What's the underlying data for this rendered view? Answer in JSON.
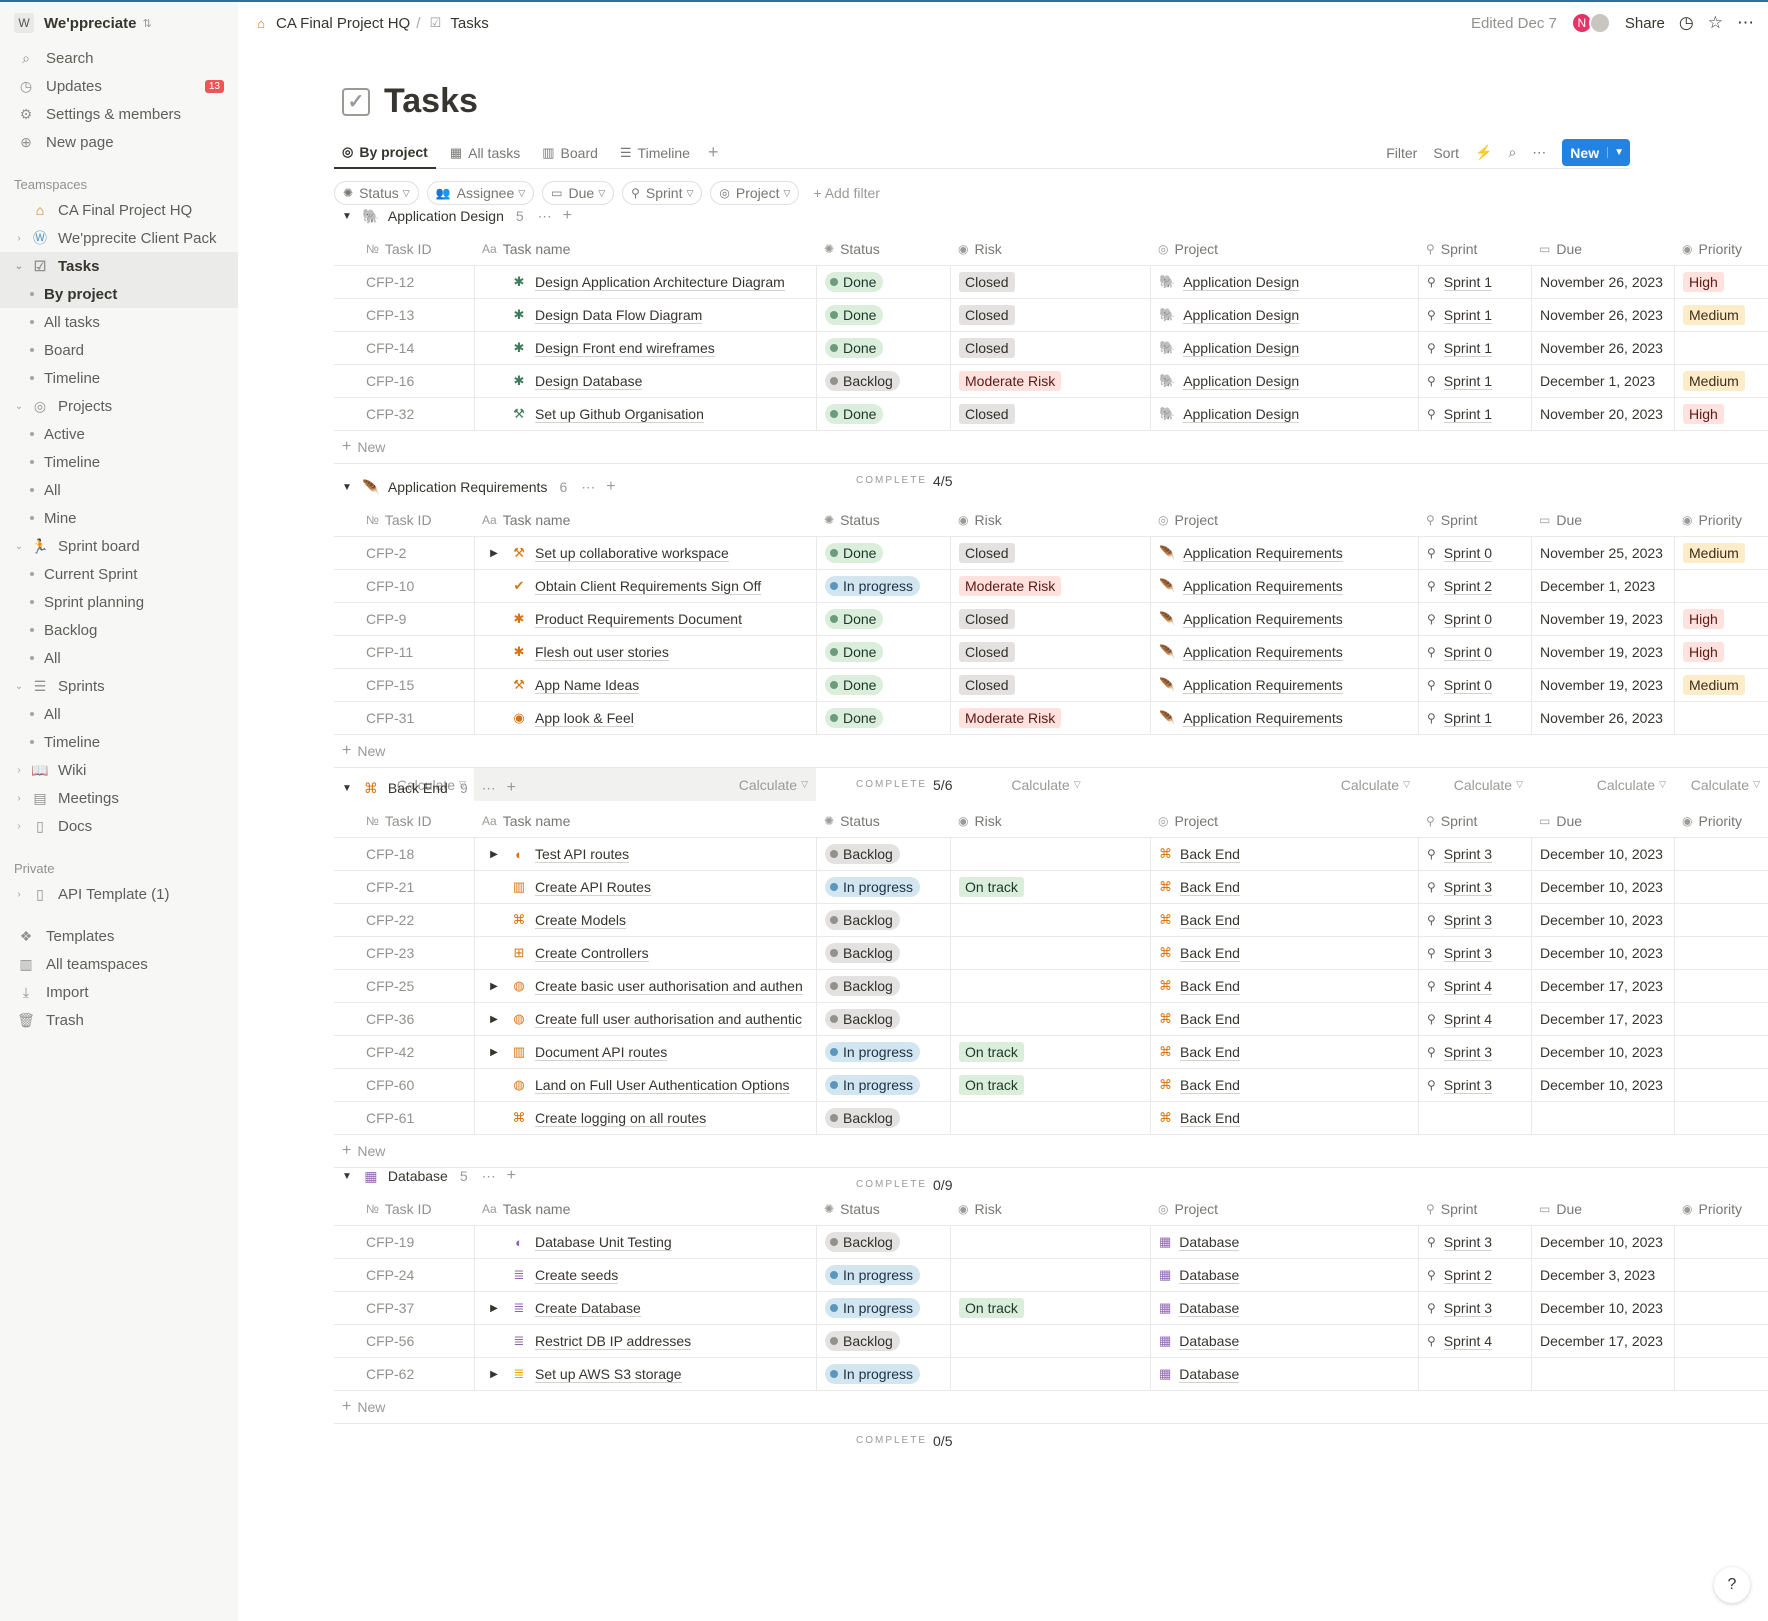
{
  "workspace": {
    "initial": "W",
    "name": "We'ppreciate"
  },
  "sidebar": {
    "top": [
      {
        "label": "Search",
        "icon": "search-icon",
        "glyph": "⌕"
      },
      {
        "label": "Updates",
        "icon": "clock-icon",
        "glyph": "◷",
        "badge": "13"
      },
      {
        "label": "Settings & members",
        "icon": "gear-icon",
        "glyph": "⚙"
      },
      {
        "label": "New page",
        "icon": "plus-circle-icon",
        "glyph": "⊕"
      }
    ],
    "teamspaces_heading": "Teamspaces",
    "teamspace_root": "CA Final Project HQ",
    "client_pack": "We'pprecite Client Pack",
    "tasks": "Tasks",
    "tasks_views": [
      "By project",
      "All tasks",
      "Board",
      "Timeline"
    ],
    "projects": "Projects",
    "projects_views": [
      "Active",
      "Timeline",
      "All",
      "Mine"
    ],
    "sprint_board": "Sprint board",
    "sprint_views": [
      "Current Sprint",
      "Sprint planning",
      "Backlog",
      "All"
    ],
    "sprints": "Sprints",
    "sprints_views": [
      "All",
      "Timeline"
    ],
    "wiki": "Wiki",
    "meetings": "Meetings",
    "docs": "Docs",
    "private_heading": "Private",
    "api_template": "API Template (1)",
    "bottom": [
      {
        "label": "Templates",
        "icon": "templates-icon",
        "glyph": "❖"
      },
      {
        "label": "All teamspaces",
        "icon": "teamspaces-icon",
        "glyph": "▥"
      },
      {
        "label": "Import",
        "icon": "import-icon",
        "glyph": "⤓"
      },
      {
        "label": "Trash",
        "icon": "trash-icon",
        "glyph": "🗑"
      }
    ]
  },
  "topbar": {
    "breadcrumb_root": "CA Final Project HQ",
    "breadcrumb_sep": "/",
    "breadcrumb_page": "Tasks",
    "edited": "Edited Dec 7",
    "avatar_initial": "N",
    "share": "Share"
  },
  "page": {
    "title": "Tasks"
  },
  "views": {
    "tabs": [
      "By project",
      "All tasks",
      "Board",
      "Timeline"
    ],
    "filter": "Filter",
    "sort": "Sort",
    "new_button": "New"
  },
  "filters": {
    "chips": [
      "Status",
      "Assignee",
      "Due",
      "Sprint",
      "Project"
    ],
    "add": "Add filter"
  },
  "columns": {
    "id": "Task ID",
    "name": "Task name",
    "status": "Status",
    "risk": "Risk",
    "project": "Project",
    "sprint": "Sprint",
    "due": "Due",
    "priority": "Priority",
    "id_icon": "№",
    "name_icon": "Aa"
  },
  "labels": {
    "new_row": "New",
    "complete": "COMPLETE",
    "calculate": "Calculate"
  },
  "colors": {
    "accent": "#2383e2",
    "badge": "#eb5757"
  },
  "groups": [
    {
      "name": "Application Design",
      "count": "5",
      "complete": "4/5",
      "icon_color": "#3f7d5a",
      "rows": [
        {
          "id": "CFP-12",
          "name": "Design Application Architecture Diagram",
          "icon": "✱",
          "icolor": "#3f7d5a",
          "exp": false,
          "status": "Done",
          "risk": "Closed",
          "project": "Application Design",
          "sprint": "Sprint 1",
          "due": "November 26, 2023",
          "priority": "High"
        },
        {
          "id": "CFP-13",
          "name": "Design Data Flow Diagram",
          "icon": "✱",
          "icolor": "#3f7d5a",
          "exp": false,
          "status": "Done",
          "risk": "Closed",
          "project": "Application Design",
          "sprint": "Sprint 1",
          "due": "November 26, 2023",
          "priority": "Medium"
        },
        {
          "id": "CFP-14",
          "name": "Design Front end wireframes",
          "icon": "✱",
          "icolor": "#3f7d5a",
          "exp": false,
          "status": "Done",
          "risk": "Closed",
          "project": "Application Design",
          "sprint": "Sprint 1",
          "due": "November 26, 2023",
          "priority": ""
        },
        {
          "id": "CFP-16",
          "name": "Design Database",
          "icon": "✱",
          "icolor": "#3f7d5a",
          "exp": false,
          "status": "Backlog",
          "risk": "Moderate Risk",
          "project": "Application Design",
          "sprint": "Sprint 1",
          "due": "December 1, 2023",
          "priority": "Medium"
        },
        {
          "id": "CFP-32",
          "name": "Set up Github Organisation",
          "icon": "⚒",
          "icolor": "#3f7d5a",
          "exp": false,
          "status": "Done",
          "risk": "Closed",
          "project": "Application Design",
          "sprint": "Sprint 1",
          "due": "November 20, 2023",
          "priority": "High"
        }
      ]
    },
    {
      "name": "Application Requirements",
      "count": "6",
      "complete": "5/6",
      "icon_color": "#d9730d",
      "calc": true,
      "rows": [
        {
          "id": "CFP-2",
          "name": "Set up collaborative workspace",
          "icon": "⚒",
          "icolor": "#d9730d",
          "exp": true,
          "status": "Done",
          "risk": "Closed",
          "project": "Application Requirements",
          "sprint": "Sprint 0",
          "due": "November 25, 2023",
          "priority": "Medium"
        },
        {
          "id": "CFP-10",
          "name": "Obtain Client Requirements Sign Off",
          "icon": "✔",
          "icolor": "#d9730d",
          "exp": false,
          "status": "In progress",
          "risk": "Moderate Risk",
          "project": "Application Requirements",
          "sprint": "Sprint 2",
          "due": "December 1, 2023",
          "priority": ""
        },
        {
          "id": "CFP-9",
          "name": "Product Requirements Document",
          "icon": "✱",
          "icolor": "#d9730d",
          "exp": false,
          "status": "Done",
          "risk": "Closed",
          "project": "Application Requirements",
          "sprint": "Sprint 0",
          "due": "November 19, 2023",
          "priority": "High"
        },
        {
          "id": "CFP-11",
          "name": "Flesh out user stories",
          "icon": "✱",
          "icolor": "#d9730d",
          "exp": false,
          "status": "Done",
          "risk": "Closed",
          "project": "Application Requirements",
          "sprint": "Sprint 0",
          "due": "November 19, 2023",
          "priority": "High"
        },
        {
          "id": "CFP-15",
          "name": "App Name Ideas",
          "icon": "⚒",
          "icolor": "#d9730d",
          "exp": false,
          "status": "Done",
          "risk": "Closed",
          "project": "Application Requirements",
          "sprint": "Sprint 0",
          "due": "November 19, 2023",
          "priority": "Medium"
        },
        {
          "id": "CFP-31",
          "name": "App look & Feel",
          "icon": "◉",
          "icolor": "#d9730d",
          "exp": false,
          "status": "Done",
          "risk": "Moderate Risk",
          "project": "Application Requirements",
          "sprint": "Sprint 1",
          "due": "November 26, 2023",
          "priority": ""
        }
      ]
    },
    {
      "name": "Back End",
      "count": "9",
      "complete": "0/9",
      "icon_color": "#d9730d",
      "rows": [
        {
          "id": "CFP-18",
          "name": "Test API routes",
          "icon": "◐",
          "icolor": "#d9730d",
          "exp": true,
          "status": "Backlog",
          "risk": "",
          "project": "Back End",
          "sprint": "Sprint 3",
          "due": "December 10, 2023",
          "priority": ""
        },
        {
          "id": "CFP-21",
          "name": "Create API Routes",
          "icon": "▥",
          "icolor": "#d9730d",
          "exp": false,
          "status": "In progress",
          "risk": "On track",
          "project": "Back End",
          "sprint": "Sprint 3",
          "due": "December 10, 2023",
          "priority": ""
        },
        {
          "id": "CFP-22",
          "name": "Create Models",
          "icon": "⌘",
          "icolor": "#d9730d",
          "exp": false,
          "status": "Backlog",
          "risk": "",
          "project": "Back End",
          "sprint": "Sprint 3",
          "due": "December 10, 2023",
          "priority": ""
        },
        {
          "id": "CFP-23",
          "name": "Create Controllers",
          "icon": "⊞",
          "icolor": "#d9730d",
          "exp": false,
          "status": "Backlog",
          "risk": "",
          "project": "Back End",
          "sprint": "Sprint 3",
          "due": "December 10, 2023",
          "priority": ""
        },
        {
          "id": "CFP-25",
          "name": "Create basic user authorisation and authen",
          "icon": "◍",
          "icolor": "#d9730d",
          "exp": true,
          "status": "Backlog",
          "risk": "",
          "project": "Back End",
          "sprint": "Sprint 4",
          "due": "December 17, 2023",
          "priority": ""
        },
        {
          "id": "CFP-36",
          "name": "Create full user authorisation and authentic",
          "icon": "◍",
          "icolor": "#d9730d",
          "exp": true,
          "status": "Backlog",
          "risk": "",
          "project": "Back End",
          "sprint": "Sprint 4",
          "due": "December 17, 2023",
          "priority": ""
        },
        {
          "id": "CFP-42",
          "name": "Document API routes",
          "icon": "▥",
          "icolor": "#d9730d",
          "exp": true,
          "status": "In progress",
          "risk": "On track",
          "project": "Back End",
          "sprint": "Sprint 3",
          "due": "December 10, 2023",
          "priority": ""
        },
        {
          "id": "CFP-60",
          "name": "Land on Full User Authentication Options",
          "icon": "◍",
          "icolor": "#d9730d",
          "exp": false,
          "status": "In progress",
          "risk": "On track",
          "project": "Back End",
          "sprint": "Sprint 3",
          "due": "December 10, 2023",
          "priority": ""
        },
        {
          "id": "CFP-61",
          "name": "Create logging on all routes",
          "icon": "⌘",
          "icolor": "#d9730d",
          "exp": false,
          "status": "Backlog",
          "risk": "",
          "project": "Back End",
          "sprint": "",
          "due": "",
          "priority": ""
        }
      ]
    },
    {
      "name": "Database",
      "count": "5",
      "complete": "0/5",
      "icon_color": "#9065b0",
      "rows": [
        {
          "id": "CFP-19",
          "name": "Database Unit Testing",
          "icon": "◐",
          "icolor": "#9065b0",
          "exp": false,
          "status": "Backlog",
          "risk": "",
          "project": "Database",
          "sprint": "Sprint 3",
          "due": "December 10, 2023",
          "priority": ""
        },
        {
          "id": "CFP-24",
          "name": "Create seeds",
          "icon": "≣",
          "icolor": "#9065b0",
          "exp": false,
          "status": "In progress",
          "risk": "",
          "project": "Database",
          "sprint": "Sprint 2",
          "due": "December 3, 2023",
          "priority": ""
        },
        {
          "id": "CFP-37",
          "name": "Create Database",
          "icon": "≣",
          "icolor": "#9065b0",
          "exp": true,
          "status": "In progress",
          "risk": "On track",
          "project": "Database",
          "sprint": "Sprint 3",
          "due": "December 10, 2023",
          "priority": ""
        },
        {
          "id": "CFP-56",
          "name": "Restrict DB IP addresses",
          "icon": "≣",
          "icolor": "#9065b0",
          "exp": false,
          "status": "Backlog",
          "risk": "",
          "project": "Database",
          "sprint": "Sprint 4",
          "due": "December 17, 2023",
          "priority": ""
        },
        {
          "id": "CFP-62",
          "name": "Set up AWS S3 storage",
          "icon": "≣",
          "icolor": "#dfab01",
          "exp": true,
          "status": "In progress",
          "risk": "",
          "project": "Database",
          "sprint": "",
          "due": "",
          "priority": ""
        }
      ]
    }
  ],
  "help": "?"
}
